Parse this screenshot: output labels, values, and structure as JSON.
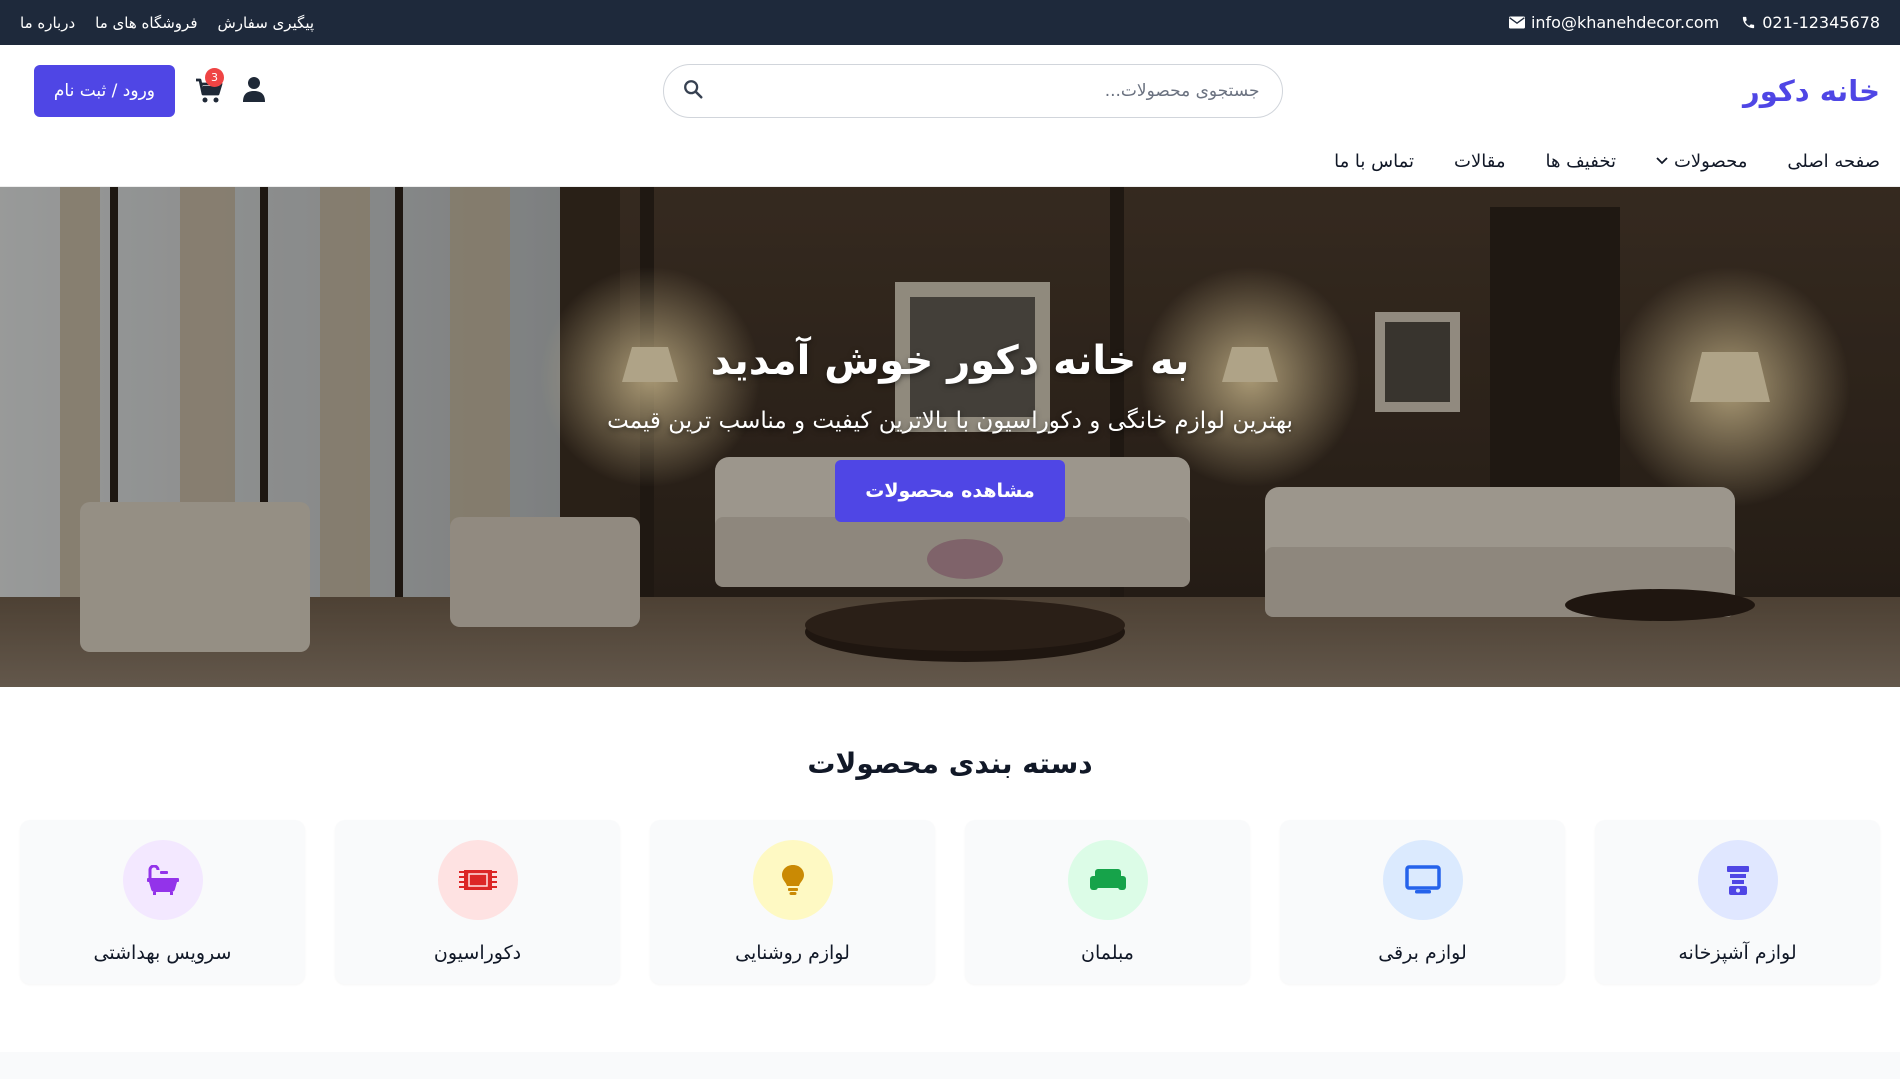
{
  "topbar": {
    "phone": "021-12345678",
    "email": "info@khanehdecor.com",
    "links": [
      "پیگیری سفارش",
      "فروشگاه های ما",
      "درباره ما"
    ]
  },
  "header": {
    "logo": "خانه دکور",
    "search_placeholder": "جستجوی محصولات...",
    "cart_count": "3",
    "login_label": "ورود / ثبت نام"
  },
  "nav": {
    "items": [
      "صفحه اصلی",
      "محصولات",
      "تخفیف ها",
      "مقالات",
      "تماس با ما"
    ]
  },
  "hero": {
    "title": "به خانه دکور خوش آمدید",
    "subtitle": "بهترین لوازم خانگی و دکوراسیون با بالاترین کیفیت و مناسب ترین قیمت",
    "cta_label": "مشاهده محصولات"
  },
  "categories": {
    "title": "دسته بندی محصولات",
    "items": [
      {
        "label": "لوازم آشپزخانه",
        "icon": "blender-icon",
        "color": "#4f46e5",
        "bg": "#e0e7ff"
      },
      {
        "label": "لوازم برقی",
        "icon": "tv-icon",
        "color": "#2563eb",
        "bg": "#dbeafe"
      },
      {
        "label": "مبلمان",
        "icon": "couch-icon",
        "color": "#16a34a",
        "bg": "#dcfce7"
      },
      {
        "label": "لوازم روشنایی",
        "icon": "lightbulb-icon",
        "color": "#ca8a04",
        "bg": "#fef9c3"
      },
      {
        "label": "دکوراسیون",
        "icon": "rug-icon",
        "color": "#dc2626",
        "bg": "#fee2e2"
      },
      {
        "label": "سرویس بهداشتی",
        "icon": "bath-icon",
        "color": "#9333ea",
        "bg": "#f3e8ff"
      }
    ]
  },
  "colors": {
    "primary": "#4f46e5",
    "topbar": "#1e293b",
    "badge": "#ef4444"
  }
}
